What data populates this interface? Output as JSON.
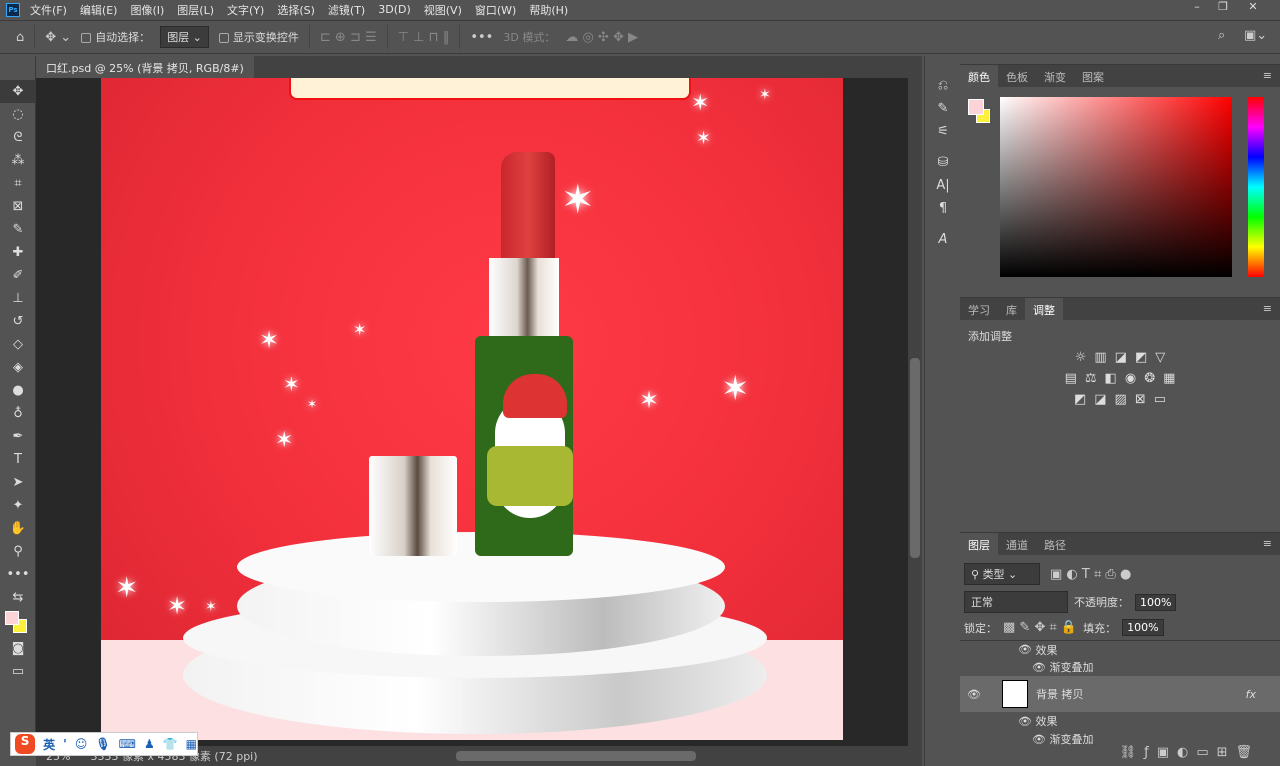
{
  "app": {
    "logo": "Ps",
    "menu": [
      "文件(F)",
      "编辑(E)",
      "图像(I)",
      "图层(L)",
      "文字(Y)",
      "选择(S)",
      "滤镜(T)",
      "3D(D)",
      "视图(V)",
      "窗口(W)",
      "帮助(H)"
    ],
    "window_controls": [
      "–",
      "❐",
      "✕"
    ]
  },
  "options": {
    "auto_select_label": "自动选择：",
    "auto_select_value": "图层",
    "show_transform_label": "显示变换控件",
    "mode3d_label": "3D 模式：",
    "more": "•••"
  },
  "document": {
    "tab_title": "口红.psd @ 25% (背景 拷贝, RGB/8#) *",
    "close": "×"
  },
  "status": {
    "zoom": "25%",
    "size": "3333 像素 x 4583 像素 (72 ppi)"
  },
  "ime": {
    "logo": "S",
    "lang": "英",
    "punct": "'"
  },
  "color_panel": {
    "tabs": [
      "颜色",
      "色板",
      "渐变",
      "图案"
    ],
    "foreground": "#fcd3d6",
    "background": "#fdf03a"
  },
  "adjust_panel": {
    "tabs": [
      "学习",
      "库",
      "调整"
    ],
    "title": "添加调整"
  },
  "layers_panel": {
    "tabs": [
      "图层",
      "通道",
      "路径"
    ],
    "filter": "类型",
    "blend": "正常",
    "opacity_label": "不透明度：",
    "opacity": "100%",
    "lock_label": "锁定：",
    "fill_label": "填充：",
    "fill": "100%",
    "rows": [
      {
        "label": "效果",
        "indent": 1
      },
      {
        "label": "渐变叠加",
        "indent": 2
      },
      {
        "label": "背景 拷贝",
        "layer": true,
        "fx": "fx"
      },
      {
        "label": "效果",
        "indent": 1
      },
      {
        "label": "渐变叠加",
        "indent": 2
      }
    ]
  },
  "colors": {
    "accent_red": "#f2303c",
    "floor_pink": "#fde0e2"
  }
}
